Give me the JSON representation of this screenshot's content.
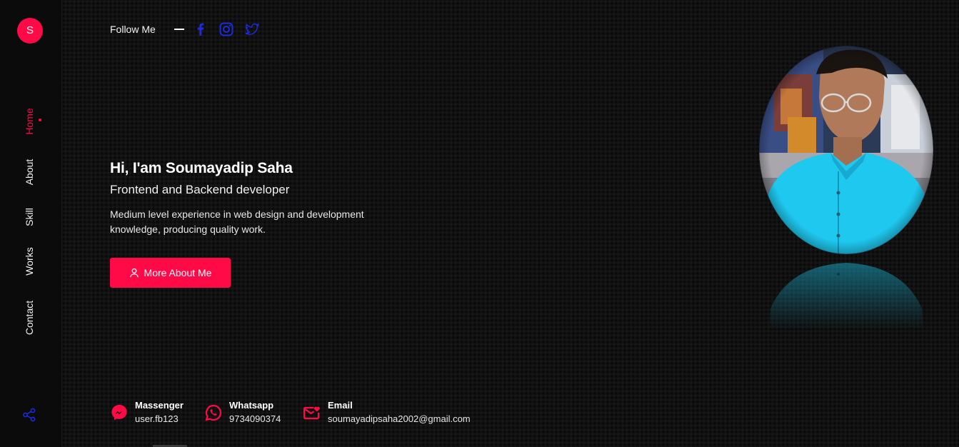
{
  "brand": {
    "logo_letter": "S",
    "accent_color": "#ff0a47"
  },
  "nav": {
    "items": [
      {
        "label": "Home",
        "active": true
      },
      {
        "label": "About",
        "active": false
      },
      {
        "label": "Skill",
        "active": false
      },
      {
        "label": "Works",
        "active": false
      },
      {
        "label": "Contact",
        "active": false
      }
    ],
    "share_icon": "share-icon"
  },
  "follow": {
    "label": "Follow Me",
    "links": [
      {
        "icon": "facebook-icon",
        "color": "#1b2bdc"
      },
      {
        "icon": "instagram-icon",
        "color": "#1b2bdc"
      },
      {
        "icon": "twitter-icon",
        "color": "#1b2bdc"
      }
    ]
  },
  "hero": {
    "greeting": "Hi, I'am Soumayadip Saha",
    "role": "Frontend and Backend developer",
    "description": "Medium level experience in web design and development knowledge, producing quality work.",
    "cta_label": "More About Me",
    "cta_icon": "user-icon"
  },
  "contacts": [
    {
      "title": "Massenger",
      "value": "user.fb123",
      "icon": "messenger-icon"
    },
    {
      "title": "Whatsapp",
      "value": "9734090374",
      "icon": "whatsapp-icon"
    },
    {
      "title": "Email",
      "value": "soumayadipsaha2002@gmail.com",
      "icon": "email-icon"
    }
  ]
}
